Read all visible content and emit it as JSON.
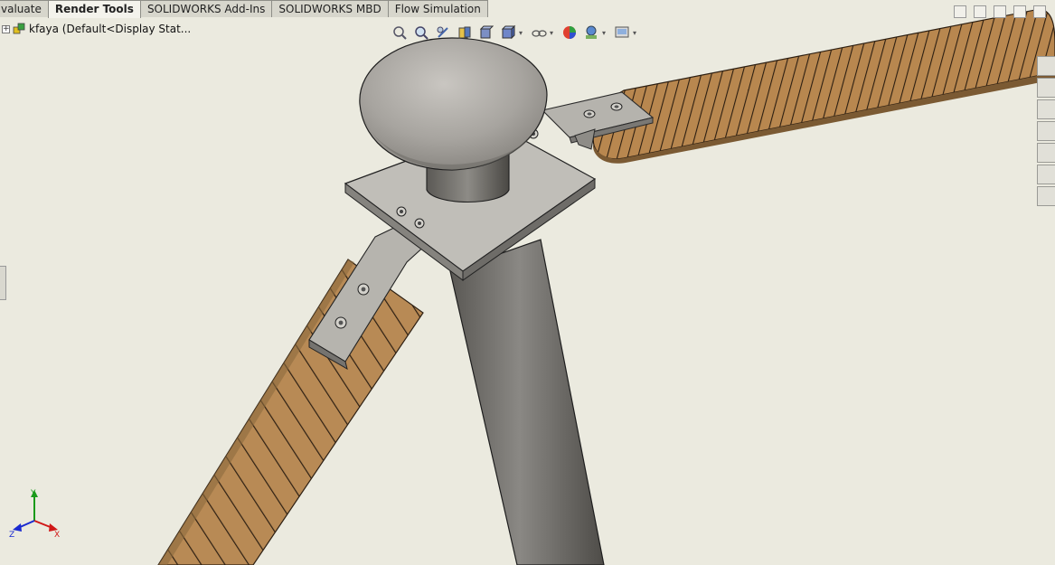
{
  "command_manager": {
    "tabs": [
      {
        "label": "valuate",
        "active": false
      },
      {
        "label": "Render Tools",
        "active": true
      },
      {
        "label": "SOLIDWORKS Add-Ins",
        "active": false
      },
      {
        "label": "SOLIDWORKS MBD",
        "active": false
      },
      {
        "label": "Flow Simulation",
        "active": false
      }
    ]
  },
  "feature_tree": {
    "expand_symbol": "+",
    "root_label": "kfaya  (Default<Display Stat..."
  },
  "heads_up_toolbar": {
    "icons": [
      "zoom-to-fit-icon",
      "zoom-to-area-icon",
      "previous-view-icon",
      "section-view-icon",
      "view-orientation-icon",
      "display-style-icon",
      "hide-show-items-icon",
      "edit-appearance-icon",
      "apply-scene-icon",
      "view-settings-icon"
    ]
  },
  "window_controls": [
    "tile-left-icon",
    "tile-right-icon",
    "minimize-icon",
    "restore-icon",
    "close-icon"
  ],
  "task_pane": [
    "home-icon",
    "design-library-icon",
    "file-explorer-icon",
    "view-palette-icon",
    "appearances-icon",
    "custom-properties-icon",
    "forum-icon"
  ],
  "triad": {
    "x": "X",
    "y": "Y",
    "z": "Z"
  },
  "colors": {
    "viewport": "#ebeadf",
    "wood": "#b88a55",
    "metal": "#b9b7b1",
    "pole": "#6e6c68",
    "axis_x": "#d01818",
    "axis_y": "#1a9a1a",
    "axis_z": "#1a2ad0"
  }
}
